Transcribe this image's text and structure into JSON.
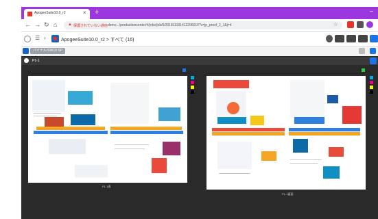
{
  "browser": {
    "tab_title": "ApogeeSuite10.0_r2",
    "tab_close": "×",
    "new_tab": "+",
    "url_security": "保護されていない通信",
    "url_path": "demo.../productioncenter/#/jobs/job/6/20181119141220601f/?v=jp_proof_2_1&j=4"
  },
  "app": {
    "breadcrumb": "ApogeeSuite10.0_r2 > すべて (16)",
    "chip_label": "バイナル/SW10 SP"
  },
  "viewer": {
    "page_label": "P1-1",
    "spread1_label": "P1-1表",
    "spread2_label": "P1-1裏面"
  },
  "colors": {
    "tabbar": "#9c37e0",
    "viewer_bg": "#2a2a2a",
    "cyan": "#00aeef",
    "magenta": "#ec008c",
    "yellow": "#fff200",
    "black": "#000000"
  }
}
